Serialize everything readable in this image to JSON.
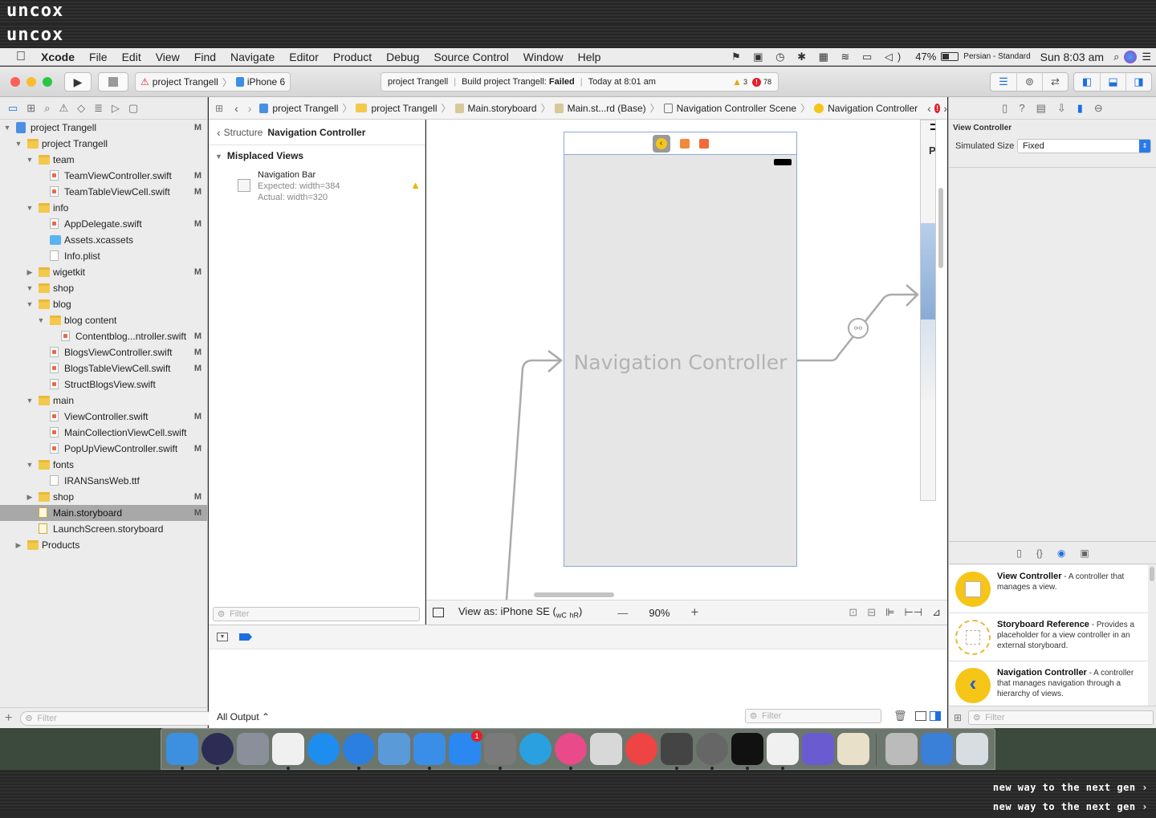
{
  "watermark": {
    "logo": "uncox",
    "slogan": "new way to the next gen ›"
  },
  "menubar": {
    "app": "Xcode",
    "items": [
      "File",
      "Edit",
      "View",
      "Find",
      "Navigate",
      "Editor",
      "Product",
      "Debug",
      "Source Control",
      "Window",
      "Help"
    ],
    "battery": "47%",
    "input_source": "Persian - Standard",
    "clock": "Sun 8:03 am"
  },
  "toolbar": {
    "scheme": "project Trangell",
    "device": "iPhone 6",
    "activity": {
      "project": "project Trangell",
      "status_prefix": "Build project Trangell: ",
      "status_result": "Failed",
      "time": "Today at 8:01 am",
      "warnings": "3",
      "errors": "78"
    }
  },
  "navigator": {
    "filter_placeholder": "Filter",
    "tree": [
      {
        "label": "project Trangell",
        "depth": 0,
        "type": "project",
        "open": true,
        "m": "M"
      },
      {
        "label": "project Trangell",
        "depth": 1,
        "type": "folder",
        "open": true,
        "m": ""
      },
      {
        "label": "team",
        "depth": 2,
        "type": "folder",
        "open": true,
        "m": ""
      },
      {
        "label": "TeamViewController.swift",
        "depth": 3,
        "type": "swift",
        "m": "M"
      },
      {
        "label": "TeamTableViewCell.swift",
        "depth": 3,
        "type": "swift",
        "m": "M"
      },
      {
        "label": "info",
        "depth": 2,
        "type": "folder",
        "open": true,
        "m": ""
      },
      {
        "label": "AppDelegate.swift",
        "depth": 3,
        "type": "swift",
        "m": "M"
      },
      {
        "label": "Assets.xcassets",
        "depth": 3,
        "type": "assets",
        "m": ""
      },
      {
        "label": "Info.plist",
        "depth": 3,
        "type": "file",
        "m": ""
      },
      {
        "label": "wigetkit",
        "depth": 2,
        "type": "folder",
        "open": false,
        "m": "M"
      },
      {
        "label": "shop",
        "depth": 2,
        "type": "folder",
        "open": true,
        "m": ""
      },
      {
        "label": "blog",
        "depth": 2,
        "type": "folder",
        "open": true,
        "m": ""
      },
      {
        "label": "blog content",
        "depth": 3,
        "type": "folder",
        "open": true,
        "m": ""
      },
      {
        "label": "Contentblog...ntroller.swift",
        "depth": 4,
        "type": "swift",
        "m": "M"
      },
      {
        "label": "BlogsViewController.swift",
        "depth": 3,
        "type": "swift",
        "m": "M"
      },
      {
        "label": "BlogsTableViewCell.swift",
        "depth": 3,
        "type": "swift",
        "m": "M"
      },
      {
        "label": "StructBlogsView.swift",
        "depth": 3,
        "type": "swift",
        "m": ""
      },
      {
        "label": "main",
        "depth": 2,
        "type": "folder",
        "open": true,
        "m": ""
      },
      {
        "label": "ViewController.swift",
        "depth": 3,
        "type": "swift",
        "m": "M"
      },
      {
        "label": "MainCollectionViewCell.swift",
        "depth": 3,
        "type": "swift",
        "m": ""
      },
      {
        "label": "PopUpViewController.swift",
        "depth": 3,
        "type": "swift",
        "m": "M"
      },
      {
        "label": "fonts",
        "depth": 2,
        "type": "folder",
        "open": true,
        "m": ""
      },
      {
        "label": "IRANSansWeb.ttf",
        "depth": 3,
        "type": "file",
        "m": ""
      },
      {
        "label": "shop",
        "depth": 2,
        "type": "folder",
        "open": false,
        "m": "M"
      },
      {
        "label": "Main.storyboard",
        "depth": 2,
        "type": "storyboard",
        "m": "M",
        "selected": true
      },
      {
        "label": "LaunchScreen.storyboard",
        "depth": 2,
        "type": "storyboard",
        "m": ""
      },
      {
        "label": "Products",
        "depth": 1,
        "type": "folder",
        "open": false,
        "m": ""
      }
    ]
  },
  "jumpbar": {
    "crumbs": [
      "project Trangell",
      "project Trangell",
      "Main.storyboard",
      "Main.st...rd (Base)",
      "Navigation Controller Scene",
      "Navigation Controller"
    ]
  },
  "outline": {
    "back_label": "Structure",
    "title": "Navigation Controller",
    "section": "Misplaced Views",
    "issue": {
      "name": "Navigation Bar",
      "expected": "Expected: width=384",
      "actual": "Actual: width=320"
    },
    "filter_placeholder": "Filter"
  },
  "canvas": {
    "scene_title": "Navigation Controller",
    "side_letter": "P",
    "view_as_prefix": "View as: iPhone SE (",
    "view_as_w": "wC",
    "view_as_h": "hR",
    "view_as_suffix": ")",
    "zoom": "90%",
    "zoom_out": "—",
    "zoom_in": "+"
  },
  "debug": {
    "output_label": "All Output",
    "filter_placeholder": "Filter"
  },
  "inspector": {
    "section": "View Controller",
    "simulated_size_label": "Simulated Size",
    "simulated_size_value": "Fixed",
    "library": [
      {
        "title": "View Controller",
        "desc": " - A controller that manages a view.",
        "color": "#f5c518",
        "style": "solid"
      },
      {
        "title": "Storyboard Reference",
        "desc": " - Provides a placeholder for a view controller in an external storyboard.",
        "color": "#e9b93a",
        "style": "dashed"
      },
      {
        "title": "Navigation Controller",
        "desc": " - A controller that manages navigation through a hierarchy of views.",
        "color": "#f5c518",
        "style": "nav"
      }
    ],
    "filter_placeholder": "Filter"
  },
  "dock": {
    "apps": [
      {
        "name": "finder-icon",
        "color": "#3d8fe0"
      },
      {
        "name": "siri-icon",
        "color": "#2c2c54"
      },
      {
        "name": "launchpad-icon",
        "color": "#8a8f99"
      },
      {
        "name": "java-icon",
        "color": "#f0f0f0"
      },
      {
        "name": "messenger-icon",
        "color": "#1e8df0"
      },
      {
        "name": "safari-icon",
        "color": "#2a7fe0"
      },
      {
        "name": "preview-icon",
        "color": "#5a9ad8"
      },
      {
        "name": "xcode-icon",
        "color": "#3a8ee8"
      },
      {
        "name": "app-store-icon",
        "color": "#2a88f0"
      },
      {
        "name": "system-preferences-icon",
        "color": "#7a7a7a"
      },
      {
        "name": "telegram-icon",
        "color": "#2aa0e0"
      },
      {
        "name": "itunes-icon",
        "color": "#e84a8a"
      },
      {
        "name": "keynote-icon",
        "color": "#d8d8d8"
      },
      {
        "name": "chrome-icon",
        "color": "#e44"
      },
      {
        "name": "sublime-text-icon",
        "color": "#444"
      },
      {
        "name": "sequel-pro-icon",
        "color": "#666"
      },
      {
        "name": "terminal-icon",
        "color": "#111"
      },
      {
        "name": "java-2-icon",
        "color": "#f0f0f0"
      },
      {
        "name": "network-icon",
        "color": "#6b5bd0"
      },
      {
        "name": "archive-icon",
        "color": "#e8e0c8"
      },
      {
        "name": "screenshot-icon",
        "color": "#bbb"
      },
      {
        "name": "downloads-icon",
        "color": "#3a7fd8"
      },
      {
        "name": "trash-icon",
        "color": "#d8dde2"
      }
    ],
    "appstore_badge": "1"
  }
}
